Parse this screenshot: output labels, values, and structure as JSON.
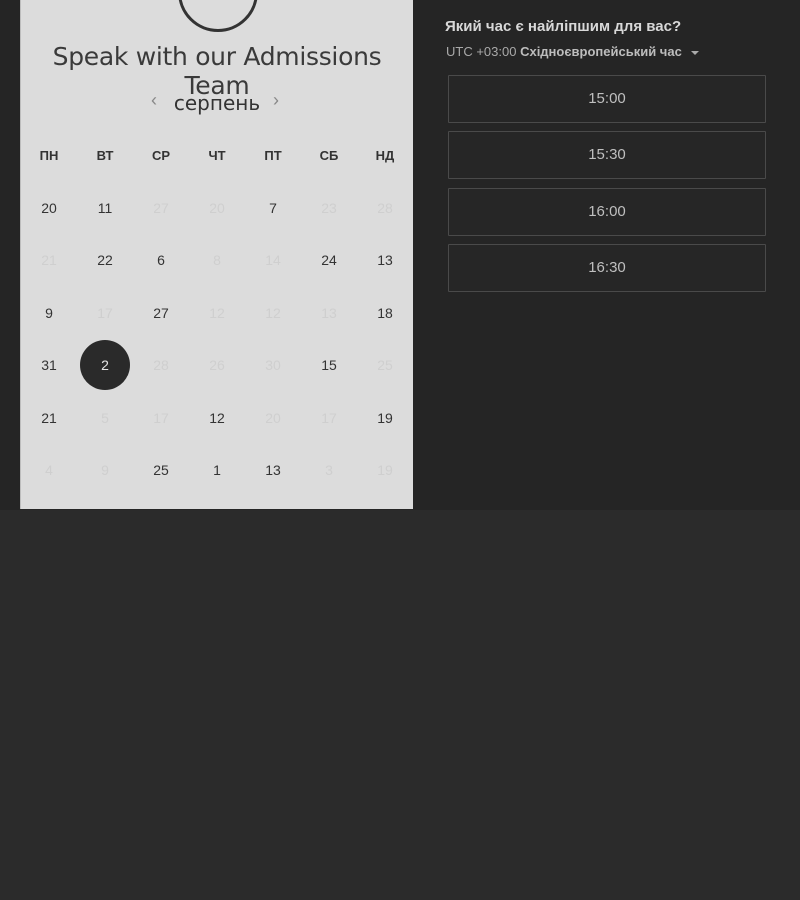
{
  "booking": {
    "title": "Speak with our Admissions Team",
    "month": "серпень",
    "prev_arrow": "‹",
    "next_arrow": "›",
    "weekdays": [
      "ПН",
      "ВТ",
      "СР",
      "ЧТ",
      "ПТ",
      "СБ",
      "НД"
    ],
    "rows": [
      [
        {
          "d": "20"
        },
        {
          "d": "11"
        },
        {
          "d": "27",
          "f": true
        },
        {
          "d": "20",
          "f": true
        },
        {
          "d": "7"
        },
        {
          "d": "23",
          "f": true
        },
        {
          "d": "28",
          "f": true
        }
      ],
      [
        {
          "d": "21",
          "f": true
        },
        {
          "d": "22"
        },
        {
          "d": "6"
        },
        {
          "d": "8",
          "f": true
        },
        {
          "d": "14",
          "f": true
        },
        {
          "d": "24"
        },
        {
          "d": "13"
        }
      ],
      [
        {
          "d": "9"
        },
        {
          "d": "17",
          "f": true
        },
        {
          "d": "27"
        },
        {
          "d": "12",
          "f": true
        },
        {
          "d": "12",
          "f": true
        },
        {
          "d": "13",
          "f": true
        },
        {
          "d": "18"
        }
      ],
      [
        {
          "d": "31"
        },
        {
          "d": "2",
          "s": true
        },
        {
          "d": "28",
          "f": true
        },
        {
          "d": "26",
          "f": true
        },
        {
          "d": "30",
          "f": true
        },
        {
          "d": "15"
        },
        {
          "d": "25",
          "f": true
        }
      ],
      [
        {
          "d": "21"
        },
        {
          "d": "5",
          "f": true
        },
        {
          "d": "17",
          "f": true
        },
        {
          "d": "12"
        },
        {
          "d": "20",
          "f": true
        },
        {
          "d": "17",
          "f": true
        },
        {
          "d": "19"
        }
      ],
      [
        {
          "d": "4",
          "f": true
        },
        {
          "d": "9",
          "f": true
        },
        {
          "d": "25"
        },
        {
          "d": "1"
        },
        {
          "d": "13"
        },
        {
          "d": "3",
          "f": true
        },
        {
          "d": "19",
          "f": true
        }
      ]
    ]
  },
  "times": {
    "question": "Який час є найліпшим для вас?",
    "tz_offset": "UTC +03:00",
    "tz_name": "Східноєвропейський час",
    "slots": [
      "15:00",
      "15:30",
      "16:00",
      "16:30"
    ]
  }
}
